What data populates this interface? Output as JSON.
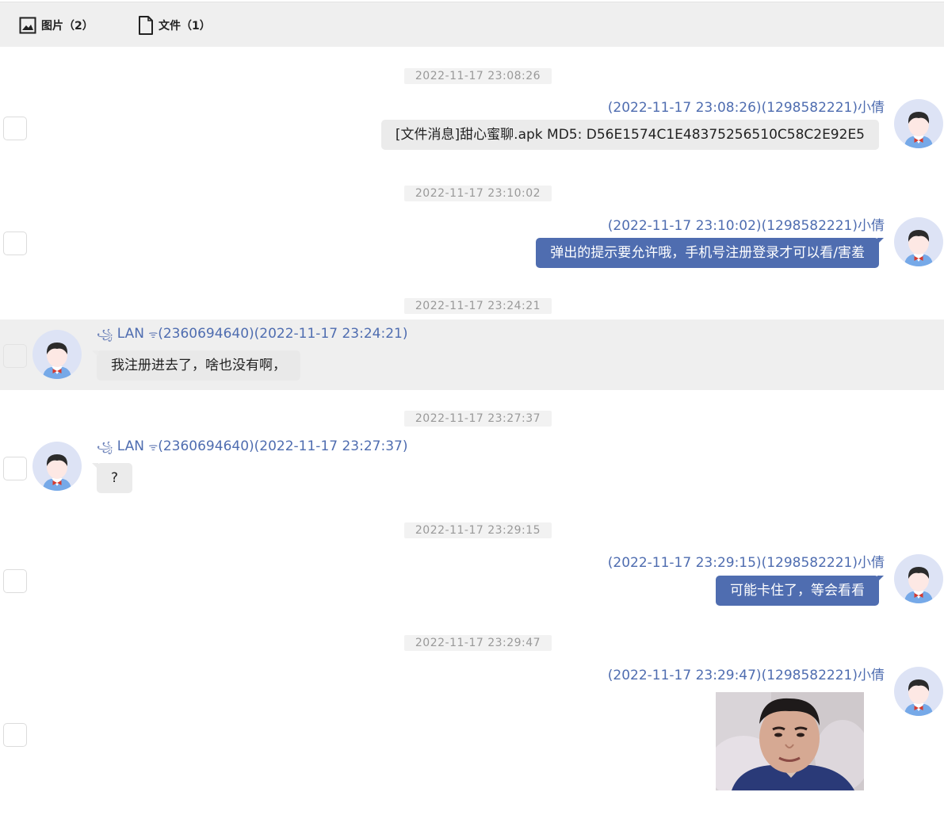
{
  "toolbar": {
    "images_label": "图片（2）",
    "files_label": "文件（1）"
  },
  "messages": [
    {
      "timestamp": "2022-11-17 23:08:26",
      "meta": "(2022-11-17 23:08:26)(1298582221)小倩",
      "text": "[文件消息]甜心蜜聊.apk MD5: D56E1574C1E48375256510C58C2E92E5"
    },
    {
      "timestamp": "2022-11-17 23:10:02",
      "meta": "(2022-11-17 23:10:02)(1298582221)小倩",
      "text": "弹出的提示要允许哦，手机号注册登录才可以看/害羞"
    },
    {
      "timestamp": "2022-11-17 23:24:21",
      "meta_name": "LAN",
      "meta_rest": "(2360694640)(2022-11-17 23:24:21)",
      "text": "我注册进去了，啥也没有啊，"
    },
    {
      "timestamp": "2022-11-17 23:27:37",
      "meta_name": "LAN",
      "meta_rest": "(2360694640)(2022-11-17 23:27:37)",
      "text": "?"
    },
    {
      "timestamp": "2022-11-17 23:29:15",
      "meta": "(2022-11-17 23:29:15)(1298582221)小倩",
      "text": "可能卡住了，等会看看"
    },
    {
      "timestamp": "2022-11-17 23:29:47",
      "meta": "(2022-11-17 23:29:47)(1298582221)小倩"
    }
  ],
  "icons": {
    "lead": "꧁",
    "trail": "ᯤ"
  },
  "colors": {
    "accent": "#4f6db0",
    "toolbar_bg": "#efefef",
    "bubble_gray": "#ebebeb",
    "avatar_bg": "#dde3f5"
  }
}
